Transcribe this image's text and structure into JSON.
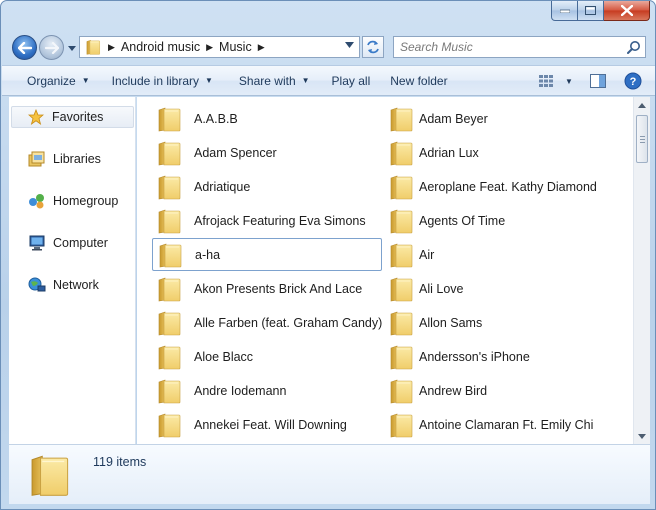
{
  "window": {
    "caption_buttons": [
      "minimize",
      "maximize",
      "close"
    ]
  },
  "address": {
    "crumbs": [
      "Android music",
      "Music"
    ]
  },
  "search": {
    "placeholder": "Search Music"
  },
  "toolbar": {
    "organize": "Organize",
    "include_in_library": "Include in library",
    "share_with": "Share with",
    "play_all": "Play all",
    "new_folder": "New folder"
  },
  "nav": {
    "items": [
      "Favorites",
      "Libraries",
      "Homegroup",
      "Computer",
      "Network"
    ]
  },
  "content": {
    "selected_item": "a-ha",
    "col1": [
      "A.A.B.B",
      "Adam Spencer",
      "Adriatique",
      "Afrojack Featuring Eva Simons",
      "a-ha",
      "Akon Presents Brick And Lace",
      "Alle Farben (feat. Graham Candy)",
      "Aloe Blacc",
      "Andre Iodemann",
      "Annekei Feat. Will Downing"
    ],
    "col2": [
      "Adam Beyer",
      "Adrian Lux",
      "Aeroplane Feat. Kathy Diamond",
      "Agents Of Time",
      "Air",
      "Ali Love",
      "Allon Sams",
      "Andersson's iPhone",
      "Andrew Bird",
      "Antoine Clamaran Ft. Emily Chi"
    ]
  },
  "details": {
    "count": "119 items"
  },
  "colors": {
    "folder_front": "#f6dc86",
    "folder_back": "#e3b94e",
    "accent_text": "#1e395b"
  }
}
